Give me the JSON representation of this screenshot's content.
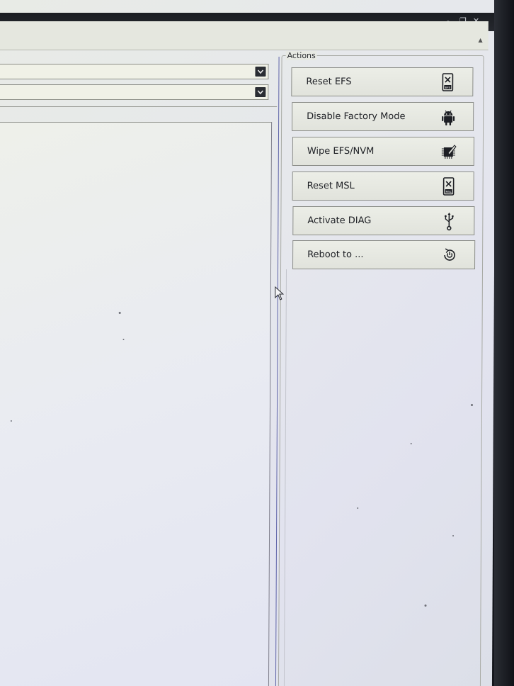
{
  "window": {
    "controls": {
      "minimize": "-",
      "restore": "❐",
      "close": "✕"
    }
  },
  "actions": {
    "title": "Actions",
    "buttons": [
      {
        "label": "Reset EFS",
        "icon": "efs-reset-icon"
      },
      {
        "label": "Disable Factory Mode",
        "icon": "android-icon"
      },
      {
        "label": "Wipe EFS/NVM",
        "icon": "chip-wipe-icon"
      },
      {
        "label": "Reset MSL",
        "icon": "msl-reset-icon"
      },
      {
        "label": "Activate DIAG",
        "icon": "usb-icon"
      },
      {
        "label": "Reboot to ...",
        "icon": "reboot-icon"
      }
    ]
  }
}
